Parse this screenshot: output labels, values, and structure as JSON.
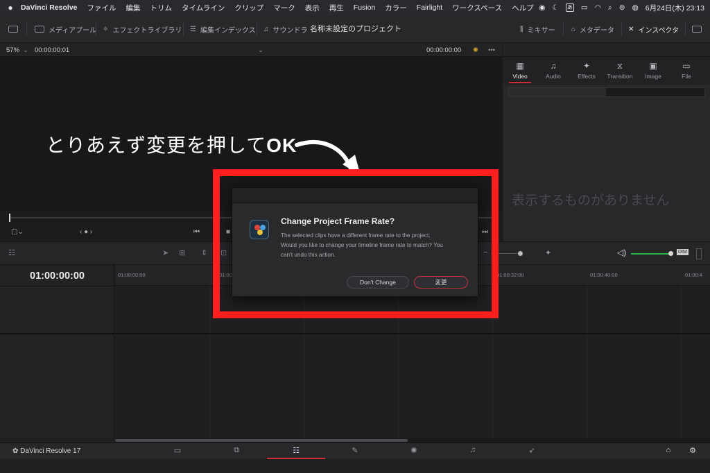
{
  "menubar": {
    "app": "DaVinci Resolve",
    "items": [
      "ファイル",
      "編集",
      "トリム",
      "タイムライン",
      "クリップ",
      "マーク",
      "表示",
      "再生",
      "Fusion",
      "カラー",
      "Fairlight",
      "ワークスペース",
      "ヘルプ"
    ],
    "input_mode": "あ",
    "datetime": "6月24日(木)  23:13"
  },
  "toolbar": {
    "media_pool": "メディアプール",
    "effects_library": "エフェクトライブラリ",
    "edit_index": "編集インデックス",
    "sound": "サウンドラ",
    "project_title": "名称未設定のプロジェクト",
    "mixer": "ミキサー",
    "metadata": "メタデータ",
    "inspector": "インスペクタ"
  },
  "viewer": {
    "zoom": "57%",
    "source_tc": "00:00:00:01",
    "record_tc": "00:00:00:00"
  },
  "inspector": {
    "tabs": [
      {
        "label": "Video",
        "icon": "film-icon",
        "glyph": "▦"
      },
      {
        "label": "Audio",
        "icon": "music-icon",
        "glyph": "♫"
      },
      {
        "label": "Effects",
        "icon": "wand-icon",
        "glyph": "✦"
      },
      {
        "label": "Transition",
        "icon": "transition-icon",
        "glyph": "⧖"
      },
      {
        "label": "Image",
        "icon": "image-icon",
        "glyph": "▣"
      },
      {
        "label": "File",
        "icon": "file-icon",
        "glyph": "▭"
      }
    ],
    "active_tab": "Video",
    "empty_message": "表示するものがありません"
  },
  "timeline": {
    "timecode": "01:00:00:00",
    "ruler": [
      "01:00:00:00",
      "01:00:08",
      "01:00:32:00",
      "01:00:40:00",
      "01:00:4"
    ],
    "audio_meter": "DIM"
  },
  "pagebar": {
    "brand": "DaVinci Resolve 17"
  },
  "annotation": {
    "text": "とりあえず変更を押して",
    "emphasis": "OK"
  },
  "dialog": {
    "title": "Change Project Frame Rate?",
    "message": "The selected clips have a different frame rate to the project. Would you like to change your timeline frame rate to match? You can't undo this action.",
    "dont_change": "Don't Change",
    "change": "変更"
  },
  "colors": {
    "highlight_frame": "#ff1f1f",
    "accent": "#d02a3a",
    "audio_meter": "#2fb84a"
  }
}
